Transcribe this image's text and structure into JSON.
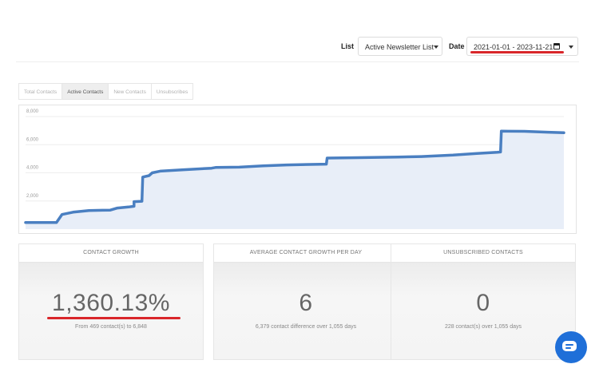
{
  "filters": {
    "list_label": "List",
    "list_value": "Active Newsletter List",
    "date_label": "Date",
    "date_value": "2021-01-01 - 2023-11-21"
  },
  "tabs": [
    {
      "label": "Total Contacts",
      "active": false
    },
    {
      "label": "Active Contacts",
      "active": true
    },
    {
      "label": "New Contacts",
      "active": false
    },
    {
      "label": "Unsubscribes",
      "active": false
    }
  ],
  "chart_data": {
    "type": "area",
    "ylim": [
      0,
      8000
    ],
    "yticks": [
      "8,000",
      "6,000",
      "4,000",
      "2,000"
    ],
    "grid": true,
    "color": "#4a7fc1",
    "fill": "#e8eef8",
    "series": [
      {
        "x": 0,
        "y": 469
      },
      {
        "x": 39,
        "y": 469
      },
      {
        "x": 46,
        "y": 1040
      },
      {
        "x": 60,
        "y": 1200
      },
      {
        "x": 80,
        "y": 1320
      },
      {
        "x": 107,
        "y": 1350
      },
      {
        "x": 116,
        "y": 1500
      },
      {
        "x": 130,
        "y": 1570
      },
      {
        "x": 137,
        "y": 1620
      },
      {
        "x": 137,
        "y": 1950
      },
      {
        "x": 147,
        "y": 1980
      },
      {
        "x": 148,
        "y": 3700
      },
      {
        "x": 156,
        "y": 3800
      },
      {
        "x": 160,
        "y": 4000
      },
      {
        "x": 170,
        "y": 4120
      },
      {
        "x": 200,
        "y": 4220
      },
      {
        "x": 235,
        "y": 4330
      },
      {
        "x": 240,
        "y": 4380
      },
      {
        "x": 270,
        "y": 4400
      },
      {
        "x": 300,
        "y": 4500
      },
      {
        "x": 330,
        "y": 4560
      },
      {
        "x": 380,
        "y": 4620
      },
      {
        "x": 381,
        "y": 5050
      },
      {
        "x": 420,
        "y": 5080
      },
      {
        "x": 470,
        "y": 5120
      },
      {
        "x": 500,
        "y": 5160
      },
      {
        "x": 540,
        "y": 5260
      },
      {
        "x": 570,
        "y": 5380
      },
      {
        "x": 596,
        "y": 5460
      },
      {
        "x": 600,
        "y": 5480
      },
      {
        "x": 601,
        "y": 6960
      },
      {
        "x": 630,
        "y": 6950
      },
      {
        "x": 660,
        "y": 6890
      },
      {
        "x": 680,
        "y": 6848
      }
    ]
  },
  "cards": [
    {
      "title": "CONTACT GROWTH",
      "value": "1,360.13%",
      "subtitle": "From 469 contact(s) to 6,848"
    },
    {
      "title": "AVERAGE CONTACT GROWTH PER DAY",
      "value": "6",
      "subtitle": "6,379 contact difference over 1,055 days"
    },
    {
      "title": "UNSUBSCRIBED CONTACTS",
      "value": "0",
      "subtitle": "228 contact(s) over 1,055 days"
    }
  ],
  "colors": {
    "accent_red": "#d9262a",
    "chat_blue": "#1f6fd8"
  },
  "icons": {
    "calendar": "calendar-icon",
    "chat": "chat-icon"
  }
}
